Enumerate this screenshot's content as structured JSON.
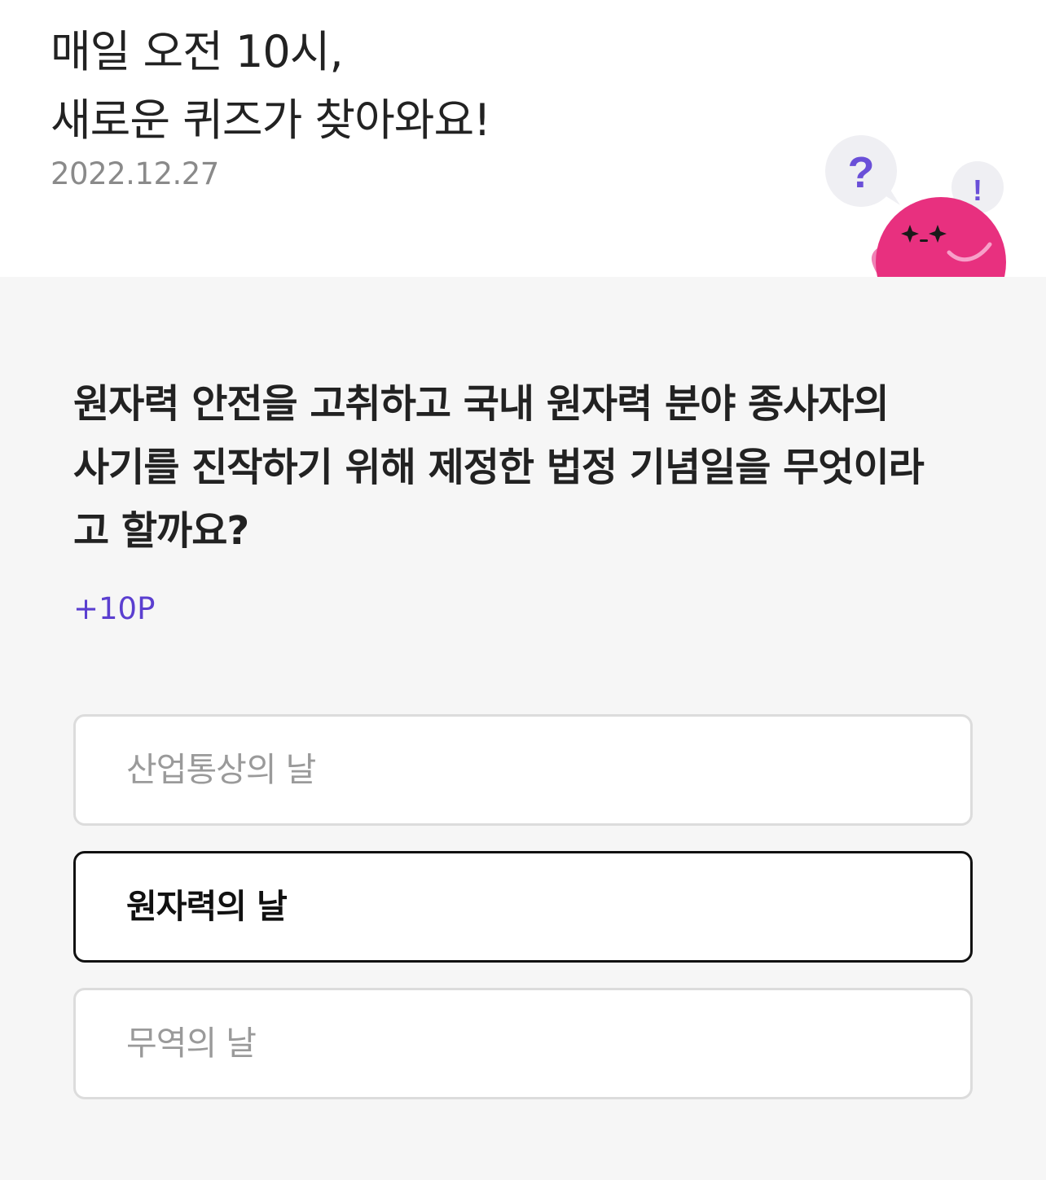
{
  "header": {
    "headline_line1": "매일 오전 10시,",
    "headline_line2": "새로운 퀴즈가 찾아와요!",
    "date": "2022.12.27",
    "mascot": {
      "icon": "quiz-mascot-icon",
      "bubble_left_symbol": "?",
      "bubble_right_symbol": "!",
      "body_color": "#e8307f",
      "symbol_color": "#6a4fd8"
    }
  },
  "quiz": {
    "question_line1": "원자력 안전을 고취하고 국내 원자력 분야 종사자의",
    "question_line2": "사기를 진작하기 위해 제정한 법정 기념일을 무엇이라",
    "question_line3": "고 할까요?",
    "points": "+10P",
    "options": [
      {
        "label": "산업통상의 날",
        "selected": false
      },
      {
        "label": "원자력의 날",
        "selected": true
      },
      {
        "label": "무역의 날",
        "selected": false
      }
    ]
  },
  "colors": {
    "accent": "#5b3fd0",
    "background": "#f6f6f6",
    "selected_border": "#111111",
    "unselected_border": "#dcdcdc"
  }
}
